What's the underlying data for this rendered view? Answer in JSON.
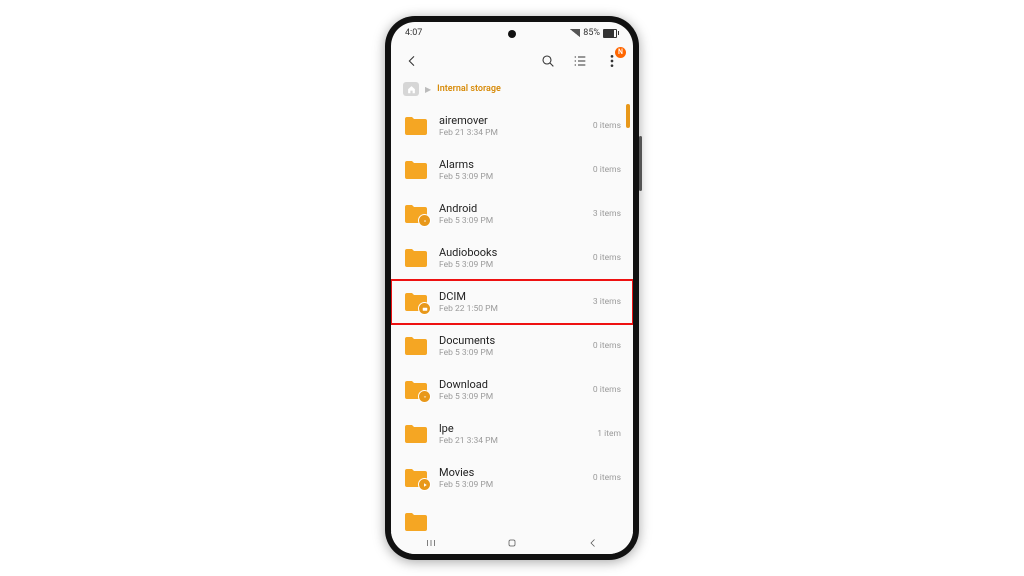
{
  "status": {
    "time": "4:07",
    "battery": "85%"
  },
  "breadcrumb": {
    "current": "Internal storage"
  },
  "highlight_index": 4,
  "folders": [
    {
      "name": "airemover",
      "date": "Feb 21 3:34 PM",
      "count": "0 items"
    },
    {
      "name": "Alarms",
      "date": "Feb 5 3:09 PM",
      "count": "0 items"
    },
    {
      "name": "Android",
      "date": "Feb 5 3:09 PM",
      "count": "3 items"
    },
    {
      "name": "Audiobooks",
      "date": "Feb 5 3:09 PM",
      "count": "0 items"
    },
    {
      "name": "DCIM",
      "date": "Feb 22 1:50 PM",
      "count": "3 items"
    },
    {
      "name": "Documents",
      "date": "Feb 5 3:09 PM",
      "count": "0 items"
    },
    {
      "name": "Download",
      "date": "Feb 5 3:09 PM",
      "count": "0 items"
    },
    {
      "name": "lpe",
      "date": "Feb 21 3:34 PM",
      "count": "1 item"
    },
    {
      "name": "Movies",
      "date": "Feb 5 3:09 PM",
      "count": "0 items"
    }
  ]
}
